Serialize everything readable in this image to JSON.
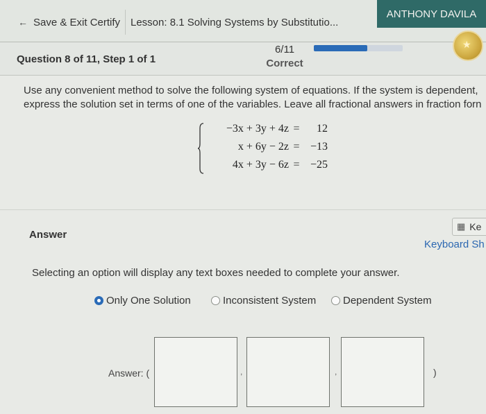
{
  "header": {
    "save_exit": "Save & Exit Certify",
    "lesson_title": "Lesson: 8.1 Solving Systems by Substitutio...",
    "user_name": "ANTHONY DAVILA"
  },
  "question_bar": {
    "question_label": "Question 8 of 11, Step 1 of 1",
    "score_fraction": "6/11",
    "score_label": "Correct",
    "progress_fraction": 0.6,
    "progress_color": "#2a6bb7"
  },
  "problem": {
    "instructions_line1": "Use any convenient method to solve the following system of equations. If the system is dependent,",
    "instructions_line2": "express the solution set in terms of one of the variables. Leave all fractional answers in fraction forn",
    "equations": [
      {
        "lhs": "−3x + 3y + 4z",
        "sign": "=",
        "rhs": "12"
      },
      {
        "lhs": "x + 6y − 2z",
        "sign": "=",
        "rhs": "−13"
      },
      {
        "lhs": "4x + 3y − 6z",
        "sign": "=",
        "rhs": "−25"
      }
    ]
  },
  "answer": {
    "label": "Answer",
    "keypad_label": "Ke",
    "keyboard_shortcuts": "Keyboard Sh",
    "select_hint": "Selecting an option will display any text boxes needed to complete your answer.",
    "options": [
      {
        "label": "Only One Solution",
        "selected": true
      },
      {
        "label": "Inconsistent System",
        "selected": false
      },
      {
        "label": "Dependent System",
        "selected": false
      }
    ],
    "answer_prefix": "Answer: (",
    "separator": ",",
    "answer_suffix": ")"
  }
}
